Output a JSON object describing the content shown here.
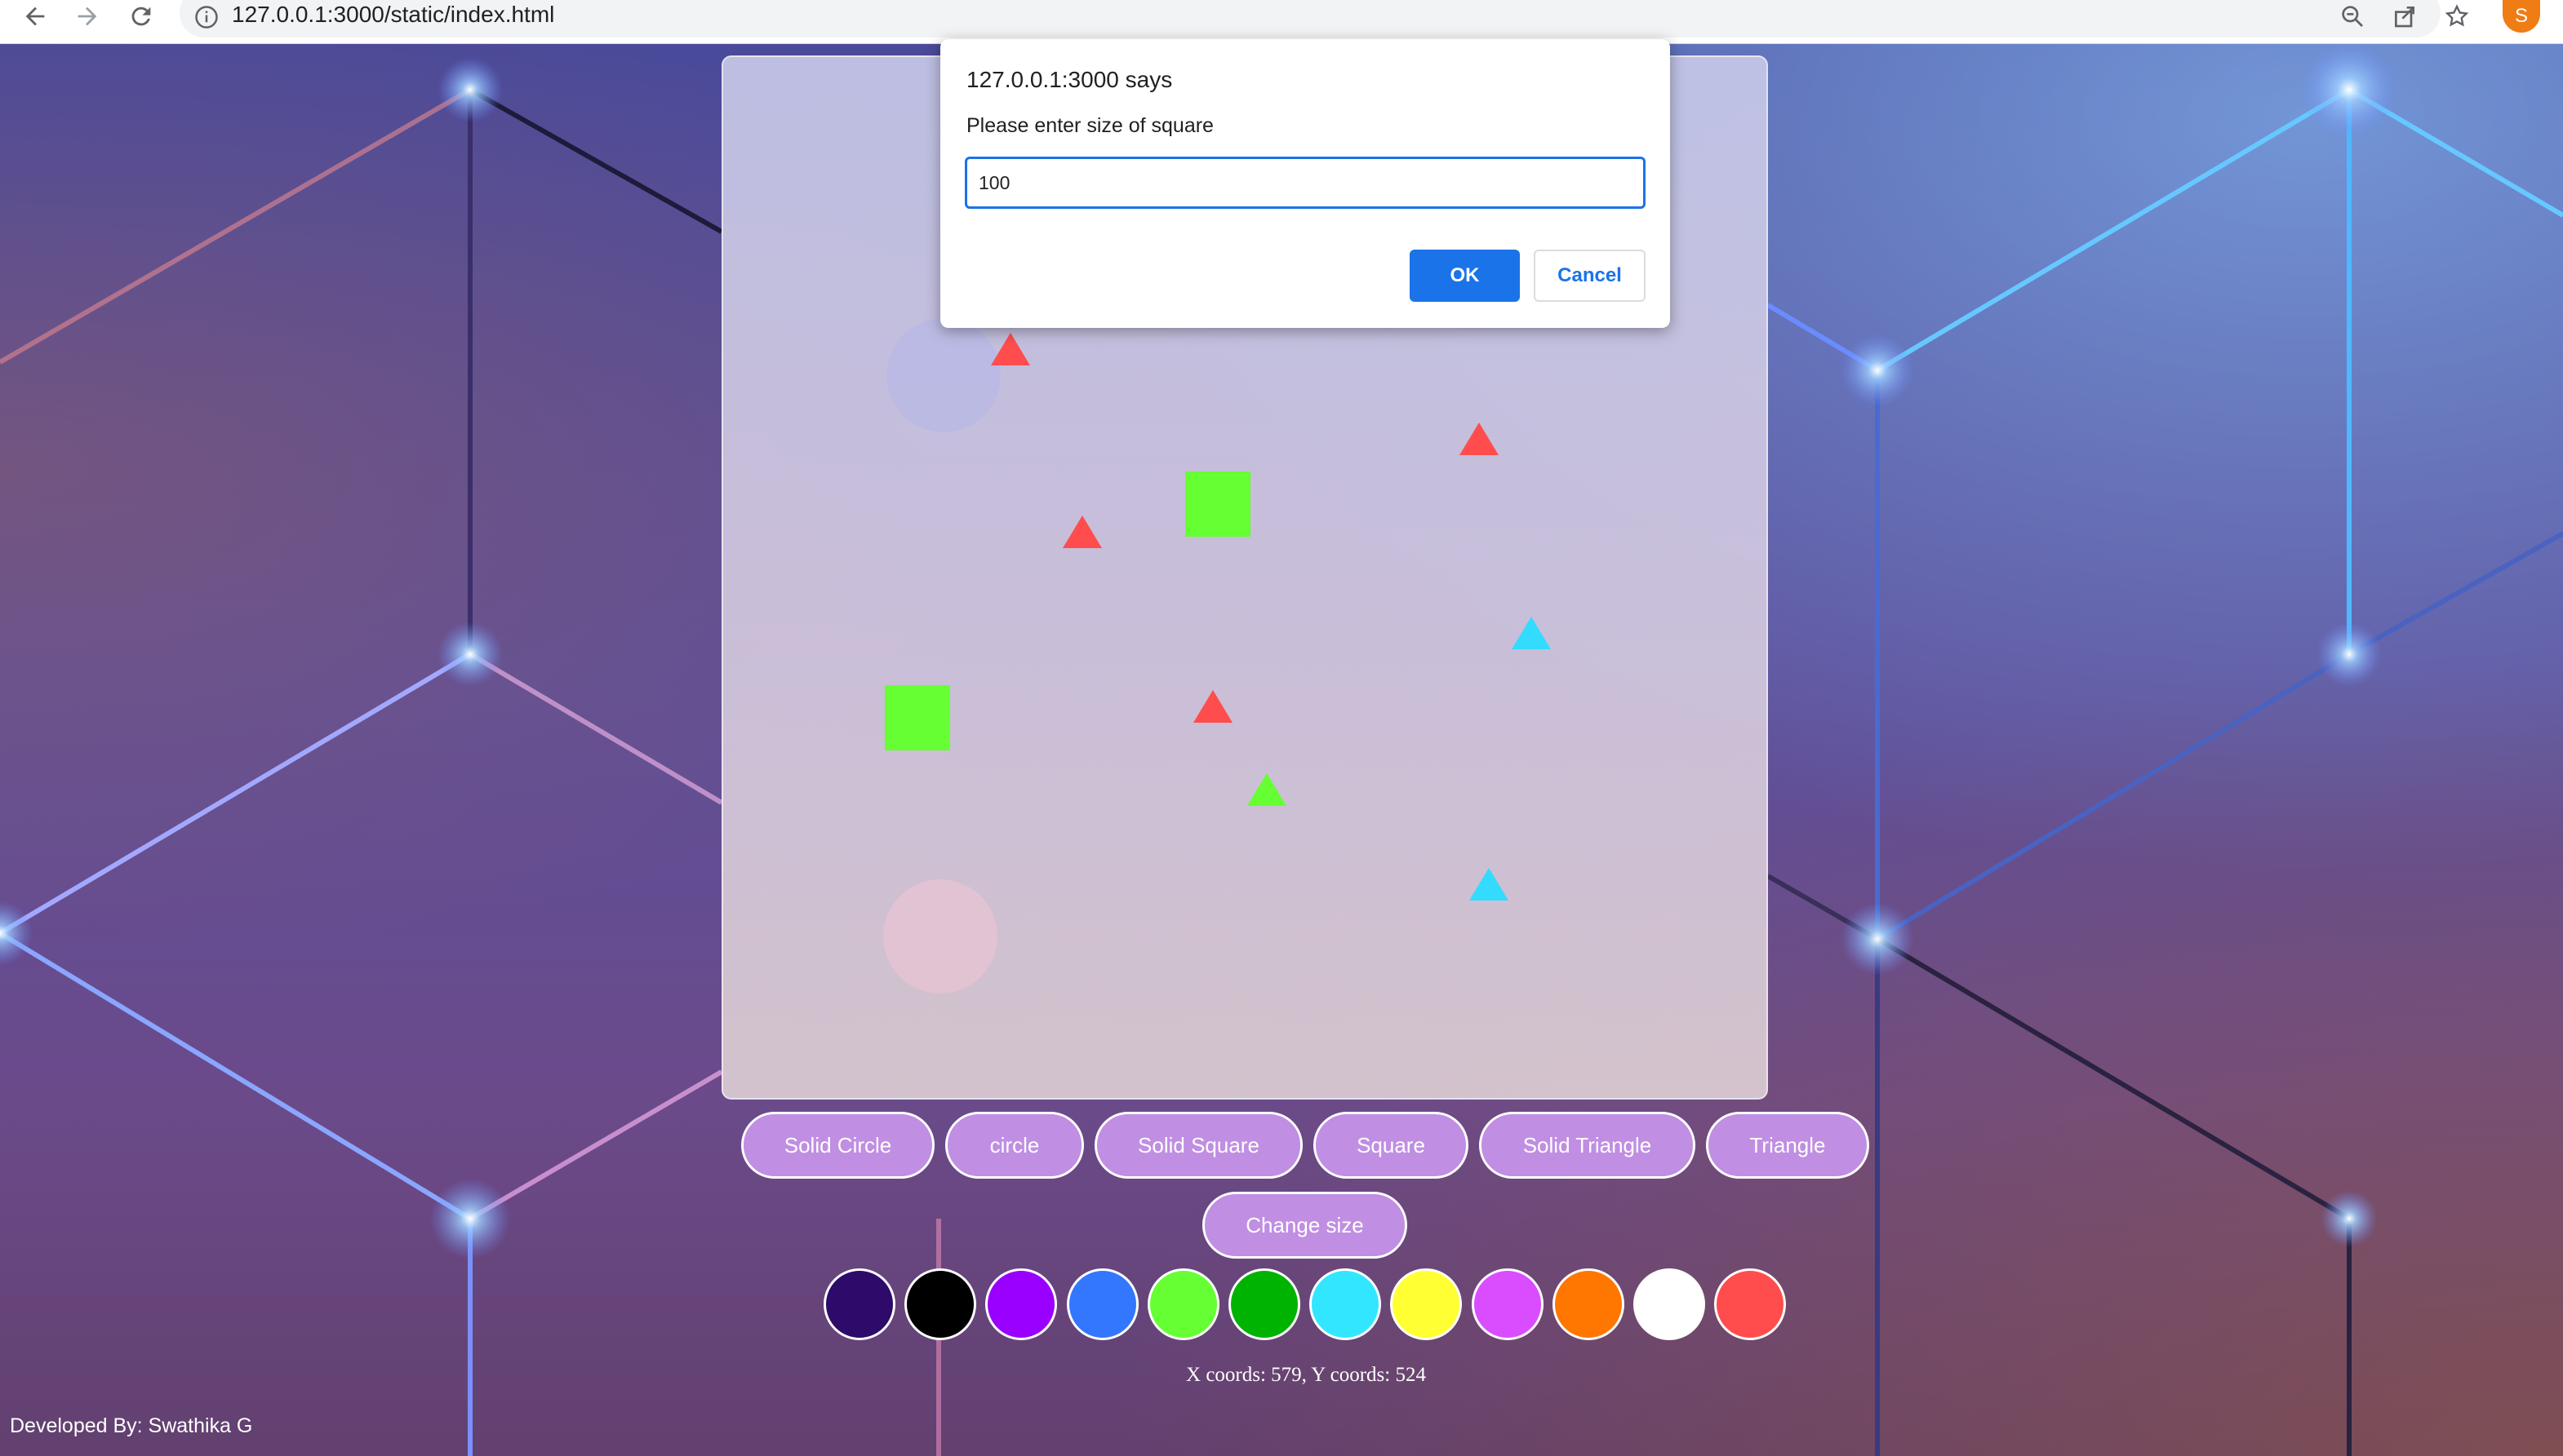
{
  "browser": {
    "url": "127.0.0.1:3000/static/index.html",
    "profile_initial": "S",
    "nav_icons": [
      "back-arrow-icon",
      "forward-arrow-icon",
      "reload-icon"
    ],
    "tool_icons": [
      "zoom-out-icon",
      "share-icon",
      "bookmark-star-icon"
    ]
  },
  "dialog": {
    "title": "127.0.0.1:3000 says",
    "message": "Please enter size of square",
    "input_value": "100",
    "ok_label": "OK",
    "cancel_label": "Cancel"
  },
  "canvas_shapes": [
    {
      "type": "triangle",
      "color": "#ff4d4d"
    },
    {
      "type": "triangle",
      "color": "#ff4d4d"
    },
    {
      "type": "square",
      "color": "#66ff33"
    },
    {
      "type": "triangle",
      "color": "#ff4d4d"
    },
    {
      "type": "triangle",
      "color": "#33dbff"
    },
    {
      "type": "square",
      "color": "#66ff33"
    },
    {
      "type": "triangle",
      "color": "#ff4d4d"
    },
    {
      "type": "triangle",
      "color": "#66ff33"
    },
    {
      "type": "triangle",
      "color": "#33dbff"
    }
  ],
  "shape_buttons": [
    "Solid Circle",
    "circle",
    "Solid Square",
    "Square",
    "Solid Triangle",
    "Triangle"
  ],
  "change_size_label": "Change size",
  "swatch_colors": [
    "#2e0a6b",
    "#000000",
    "#9900ff",
    "#3377ff",
    "#66ff33",
    "#00b300",
    "#33e6ff",
    "#ffff33",
    "#d94dff",
    "#ff7700",
    "#ffffff",
    "#ff4d4d"
  ],
  "coords_text": "X coords: 579, Y coords: 524",
  "credit_text": "Developed By: Swathika G",
  "colors": {
    "button_fill": "#c08ee2",
    "dialog_accent": "#1a73e8"
  }
}
